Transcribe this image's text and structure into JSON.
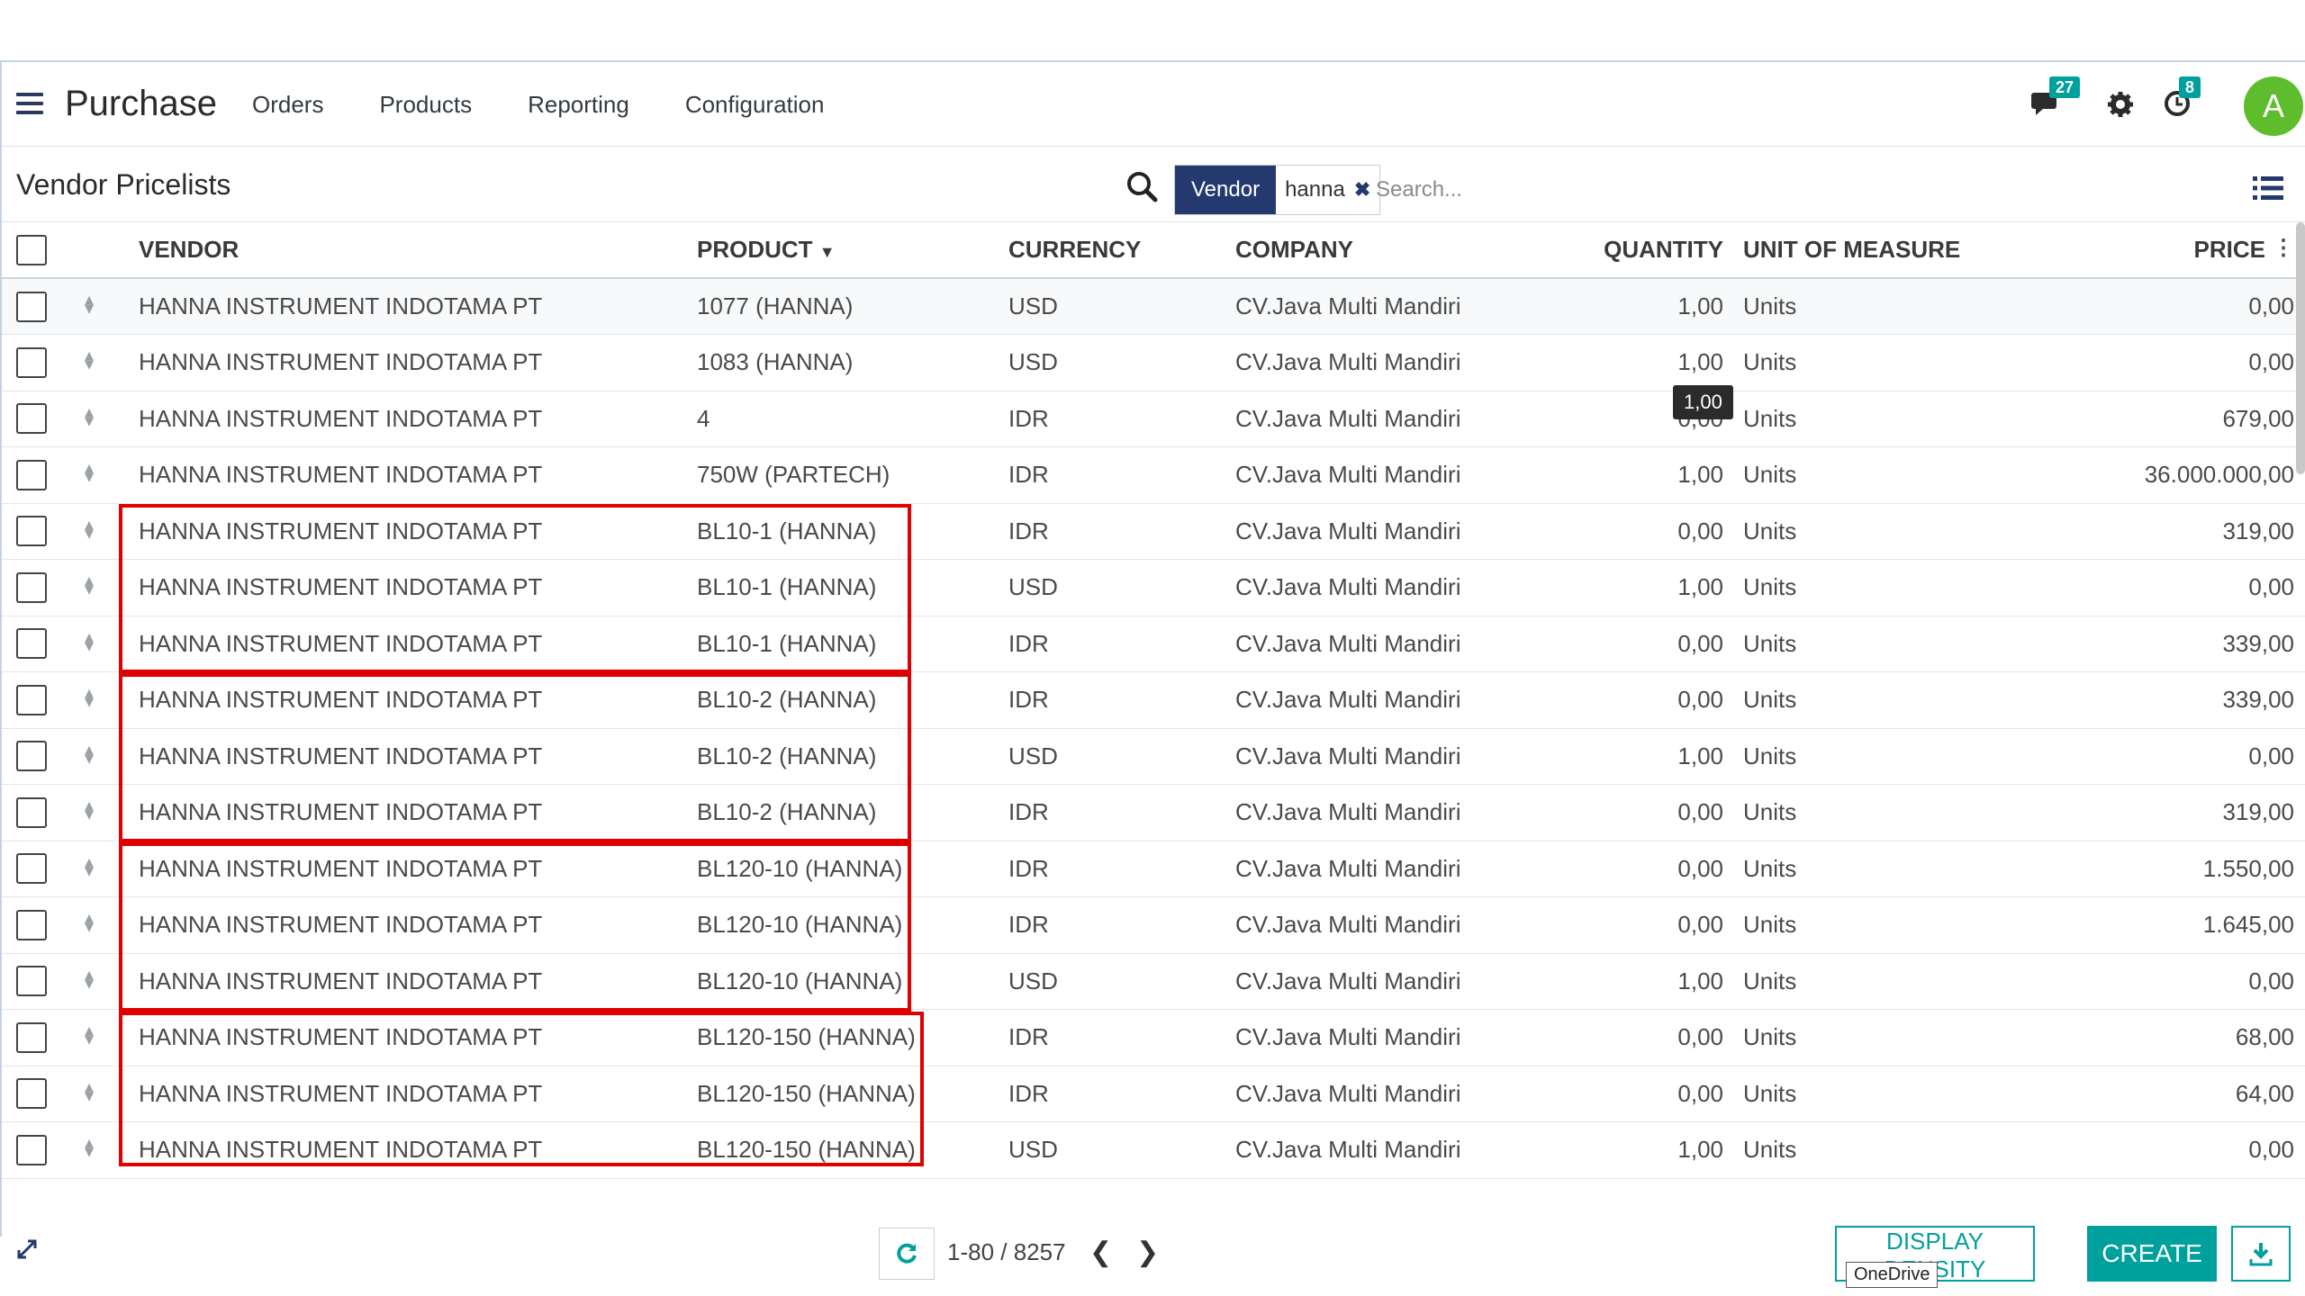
{
  "navbar": {
    "app_title": "Purchase",
    "menu": [
      "Orders",
      "Products",
      "Reporting",
      "Configuration"
    ],
    "messages_count": "27",
    "activities_count": "8",
    "avatar_letter": "A"
  },
  "control": {
    "breadcrumb": "Vendor Pricelists",
    "facet_category": "Vendor",
    "facet_value": "hanna",
    "search_placeholder": "Search..."
  },
  "table": {
    "headers": {
      "vendor": "VENDOR",
      "product": "PRODUCT",
      "currency": "CURRENCY",
      "company": "COMPANY",
      "quantity": "QUANTITY",
      "uom": "UNIT OF MEASURE",
      "price": "PRICE"
    },
    "rows": [
      {
        "vendor": "HANNA INSTRUMENT INDOTAMA PT",
        "product": "1077 (HANNA)",
        "currency": "USD",
        "company": "CV.Java Multi Mandiri",
        "quantity": "1,00",
        "uom": "Units",
        "price": "0,00"
      },
      {
        "vendor": "HANNA INSTRUMENT INDOTAMA PT",
        "product": "1083 (HANNA)",
        "currency": "USD",
        "company": "CV.Java Multi Mandiri",
        "quantity": "1,00",
        "uom": "Units",
        "price": "0,00"
      },
      {
        "vendor": "HANNA INSTRUMENT INDOTAMA PT",
        "product": "4",
        "currency": "IDR",
        "company": "CV.Java Multi Mandiri",
        "quantity": "0,00",
        "uom": "Units",
        "price": "679,00"
      },
      {
        "vendor": "HANNA INSTRUMENT INDOTAMA PT",
        "product": "750W (PARTECH)",
        "currency": "IDR",
        "company": "CV.Java Multi Mandiri",
        "quantity": "1,00",
        "uom": "Units",
        "price": "36.000.000,00"
      },
      {
        "vendor": "HANNA INSTRUMENT INDOTAMA PT",
        "product": "BL10-1 (HANNA)",
        "currency": "IDR",
        "company": "CV.Java Multi Mandiri",
        "quantity": "0,00",
        "uom": "Units",
        "price": "319,00"
      },
      {
        "vendor": "HANNA INSTRUMENT INDOTAMA PT",
        "product": "BL10-1 (HANNA)",
        "currency": "USD",
        "company": "CV.Java Multi Mandiri",
        "quantity": "1,00",
        "uom": "Units",
        "price": "0,00"
      },
      {
        "vendor": "HANNA INSTRUMENT INDOTAMA PT",
        "product": "BL10-1 (HANNA)",
        "currency": "IDR",
        "company": "CV.Java Multi Mandiri",
        "quantity": "0,00",
        "uom": "Units",
        "price": "339,00"
      },
      {
        "vendor": "HANNA INSTRUMENT INDOTAMA PT",
        "product": "BL10-2 (HANNA)",
        "currency": "IDR",
        "company": "CV.Java Multi Mandiri",
        "quantity": "0,00",
        "uom": "Units",
        "price": "339,00"
      },
      {
        "vendor": "HANNA INSTRUMENT INDOTAMA PT",
        "product": "BL10-2 (HANNA)",
        "currency": "USD",
        "company": "CV.Java Multi Mandiri",
        "quantity": "1,00",
        "uom": "Units",
        "price": "0,00"
      },
      {
        "vendor": "HANNA INSTRUMENT INDOTAMA PT",
        "product": "BL10-2 (HANNA)",
        "currency": "IDR",
        "company": "CV.Java Multi Mandiri",
        "quantity": "0,00",
        "uom": "Units",
        "price": "319,00"
      },
      {
        "vendor": "HANNA INSTRUMENT INDOTAMA PT",
        "product": "BL120-10 (HANNA)",
        "currency": "IDR",
        "company": "CV.Java Multi Mandiri",
        "quantity": "0,00",
        "uom": "Units",
        "price": "1.550,00"
      },
      {
        "vendor": "HANNA INSTRUMENT INDOTAMA PT",
        "product": "BL120-10 (HANNA)",
        "currency": "IDR",
        "company": "CV.Java Multi Mandiri",
        "quantity": "0,00",
        "uom": "Units",
        "price": "1.645,00"
      },
      {
        "vendor": "HANNA INSTRUMENT INDOTAMA PT",
        "product": "BL120-10 (HANNA)",
        "currency": "USD",
        "company": "CV.Java Multi Mandiri",
        "quantity": "1,00",
        "uom": "Units",
        "price": "0,00"
      },
      {
        "vendor": "HANNA INSTRUMENT INDOTAMA PT",
        "product": "BL120-150 (HANNA)",
        "currency": "IDR",
        "company": "CV.Java Multi Mandiri",
        "quantity": "0,00",
        "uom": "Units",
        "price": "68,00"
      },
      {
        "vendor": "HANNA INSTRUMENT INDOTAMA PT",
        "product": "BL120-150 (HANNA)",
        "currency": "IDR",
        "company": "CV.Java Multi Mandiri",
        "quantity": "0,00",
        "uom": "Units",
        "price": "64,00"
      },
      {
        "vendor": "HANNA INSTRUMENT INDOTAMA PT",
        "product": "BL120-150 (HANNA)",
        "currency": "USD",
        "company": "CV.Java Multi Mandiri",
        "quantity": "1,00",
        "uom": "Units",
        "price": "0,00"
      }
    ],
    "tooltip": "1,00"
  },
  "footer": {
    "pager": "1-80 / 8257",
    "density_label": "DISPLAY DENSITY",
    "onedrive_tooltip": "OneDrive",
    "create_label": "CREATE"
  },
  "colors": {
    "accent": "#00a09d",
    "facet": "#243a6e",
    "highlight": "#e00000",
    "avatar": "#5ebd2c"
  }
}
